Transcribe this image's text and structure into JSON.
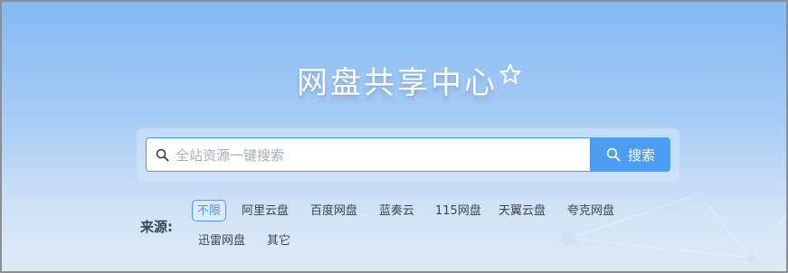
{
  "header": {
    "title": "网盘共享中心",
    "favorite_icon": "star-outline-icon"
  },
  "search": {
    "placeholder": "全站资源一键搜索",
    "value": "",
    "button_label": "搜索",
    "icon": "search-icon"
  },
  "filters": {
    "label": "来源:",
    "selected": "不限",
    "items": [
      {
        "label": "不限",
        "active": true
      },
      {
        "label": "阿里云盘",
        "active": false
      },
      {
        "label": "百度网盘",
        "active": false
      },
      {
        "label": "蓝奏云",
        "active": false
      },
      {
        "label": "115网盘",
        "active": false
      },
      {
        "label": "天翼云盘",
        "active": false
      },
      {
        "label": "夸克网盘",
        "active": false
      },
      {
        "label": "迅雷网盘",
        "active": false
      },
      {
        "label": "其它",
        "active": false
      }
    ]
  },
  "colors": {
    "accent": "#4d9df0",
    "background_top": "#84b9f4",
    "background_bottom": "#dfe9f4",
    "text": "#3b4452"
  }
}
